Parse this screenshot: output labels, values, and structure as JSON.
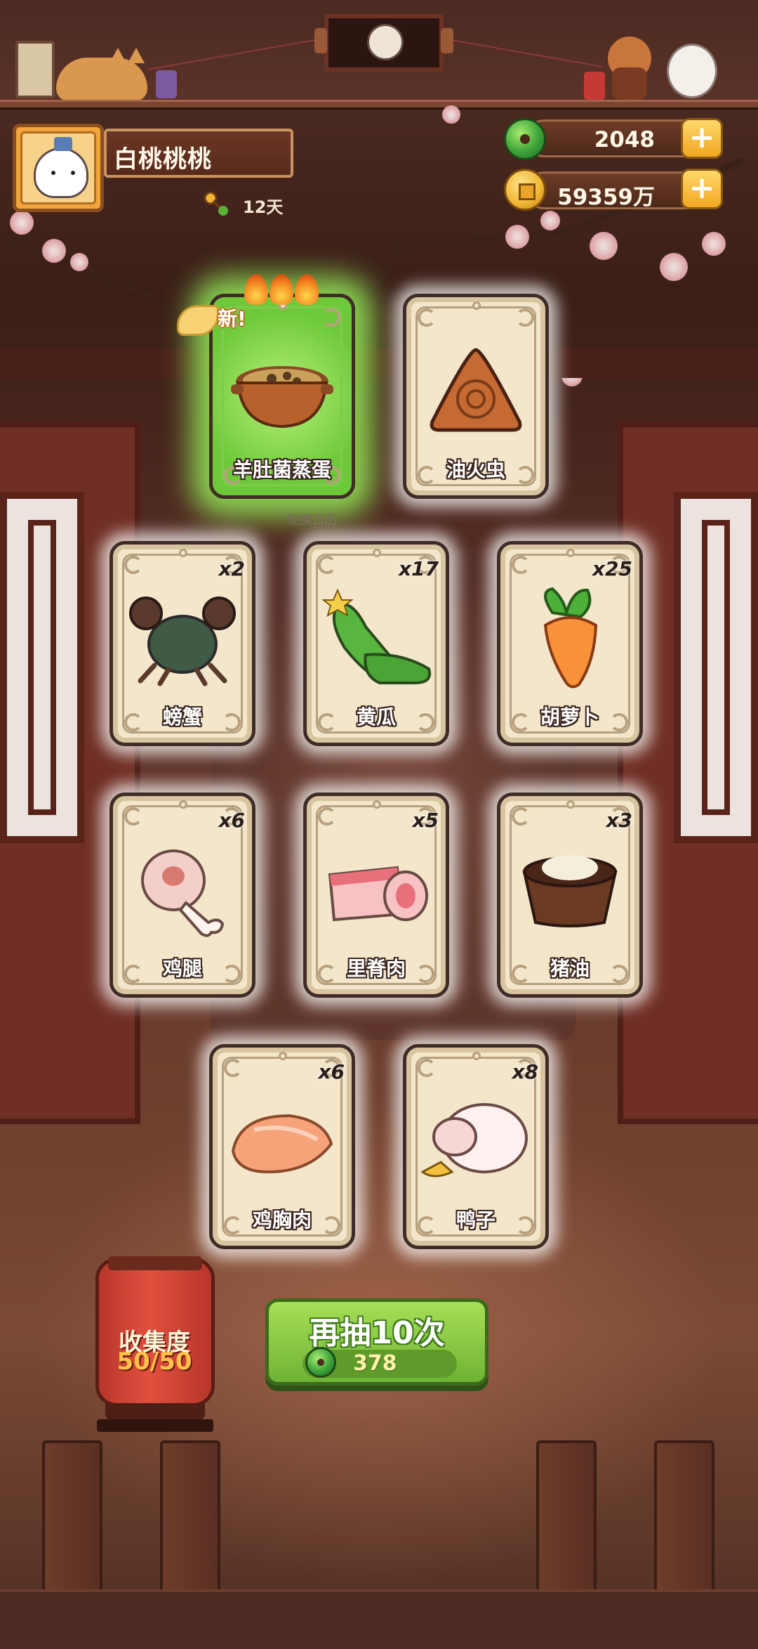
{
  "profile": {
    "name": "白桃桃桃",
    "days": "12天"
  },
  "currency": {
    "jade": {
      "value": "2048",
      "icon": "jade-coin-icon"
    },
    "coins": {
      "value": "59359万",
      "icon": "gold-coin-icon"
    },
    "plus_label": "+"
  },
  "featured": {
    "new_badge": "新!",
    "rotation_label": "轮换日历",
    "cards": [
      {
        "name": "羊肚菌蒸蛋",
        "icon": "steamed-egg-pot-icon",
        "highlighted": true
      },
      {
        "name": "油火虫",
        "icon": "firefly-pastry-icon",
        "highlighted": false
      }
    ]
  },
  "ingredients": [
    {
      "name": "螃蟹",
      "count": "x2",
      "icon": "crab-icon"
    },
    {
      "name": "黄瓜",
      "count": "x17",
      "icon": "cucumber-icon"
    },
    {
      "name": "胡萝卜",
      "count": "x25",
      "icon": "carrot-icon"
    },
    {
      "name": "鸡腿",
      "count": "x6",
      "icon": "drumstick-icon"
    },
    {
      "name": "里脊肉",
      "count": "x5",
      "icon": "tenderloin-icon"
    },
    {
      "name": "猪油",
      "count": "x3",
      "icon": "lard-icon"
    },
    {
      "name": "鸡胸肉",
      "count": "x6",
      "icon": "chicken-breast-icon"
    },
    {
      "name": "鸭子",
      "count": "x8",
      "icon": "duck-icon"
    }
  ],
  "collection": {
    "title": "收集度",
    "progress": "50/50"
  },
  "draw": {
    "label": "再抽10次",
    "cost": "378",
    "cost_icon": "jade-coin-icon"
  },
  "colors": {
    "accent_green": "#7cc23f",
    "card_bg": "#f3e6cb",
    "lantern_red": "#d9473a",
    "gold": "#f1b534"
  }
}
